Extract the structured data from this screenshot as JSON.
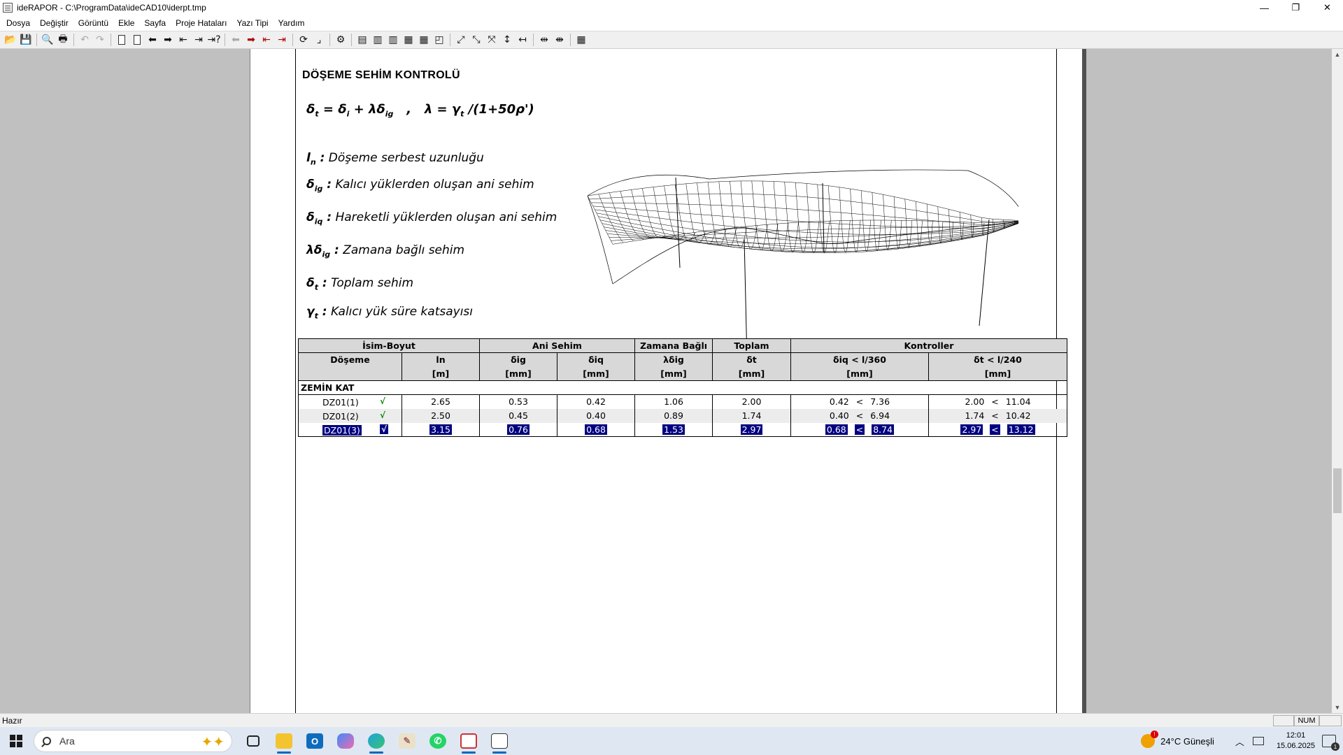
{
  "window": {
    "title": "ideRAPOR - C:\\ProgramData\\ideCAD10\\iderpt.tmp",
    "controls": {
      "minimize": "—",
      "restore": "❐",
      "close": "✕"
    }
  },
  "menu": [
    "Dosya",
    "Değiştir",
    "Görüntü",
    "Ekle",
    "Sayfa",
    "Proje Hataları",
    "Yazı Tipi",
    "Yardım"
  ],
  "toolbar": {
    "open": "📂",
    "save": "💾",
    "preview": "🔍",
    "print": "🖶",
    "undo": "↶",
    "redo": "↷",
    "prev": "⬅",
    "next": "➡",
    "first": "⇤",
    "last": "⇥",
    "goto": "⇥?",
    "icons": [
      "open-icon",
      "save-icon",
      "print-preview-icon",
      "print-icon",
      "undo-icon",
      "redo-icon"
    ]
  },
  "report": {
    "heading": "DÖŞEME SEHİM  KONTROLÜ",
    "legend": [
      {
        "sym": "l",
        "sub": "n",
        "text": " Döşeme serbest uzunluğu"
      },
      {
        "sym": "δ",
        "sub": "ig",
        "text": " Kalıcı yüklerden oluşan ani sehim"
      },
      {
        "sym": "δ",
        "sub": "iq",
        "text": " Hareketli yüklerden oluşan ani sehim"
      },
      {
        "sym": "λδ",
        "sub": "ig",
        "text": " Zamana bağlı sehim"
      },
      {
        "sym": "δ",
        "sub": "t",
        "text": " Toplam sehim"
      },
      {
        "sym": "γ",
        "sub": "t",
        "text": " Kalıcı yük süre katsayısı"
      }
    ],
    "table": {
      "groups": [
        "İsim-Boyut",
        "Ani Sehim",
        "Zamana Bağlı",
        "Toplam",
        "Kontroller"
      ],
      "subheaders": [
        "Döşeme",
        "ln",
        "δig",
        "δiq",
        "λδig",
        "δt",
        "δiq < l/360",
        "δt < l/240"
      ],
      "units": [
        "",
        "[m]",
        "[mm]",
        "[mm]",
        "[mm]",
        "[mm]",
        "[mm]",
        "[mm]"
      ],
      "section": "ZEMİN KAT",
      "rows": [
        {
          "name": "DZ01(1)",
          "check": "√",
          "ln": "2.65",
          "dig": "0.53",
          "diq": "0.42",
          "ldig": "1.06",
          "dt": "2.00",
          "c1a": "0.42",
          "c1op": "<",
          "c1b": "7.36",
          "c2a": "2.00",
          "c2op": "<",
          "c2b": "11.04"
        },
        {
          "name": "DZ01(2)",
          "check": "√",
          "ln": "2.50",
          "dig": "0.45",
          "diq": "0.40",
          "ldig": "0.89",
          "dt": "1.74",
          "c1a": "0.40",
          "c1op": "<",
          "c1b": "6.94",
          "c2a": "1.74",
          "c2op": "<",
          "c2b": "10.42"
        },
        {
          "name": "DZ01(3)",
          "check": "√",
          "ln": "3.15",
          "dig": "0.76",
          "diq": "0.68",
          "ldig": "1.53",
          "dt": "2.97",
          "c1a": "0.68",
          "c1op": "<",
          "c1b": "8.74",
          "c2a": "2.97",
          "c2op": "<",
          "c2b": "13.12"
        }
      ]
    }
  },
  "status": {
    "text": "Hazır",
    "num": "NUM"
  },
  "taskbar": {
    "search_placeholder": "Ara",
    "weather": "24°C  Güneşli",
    "time": "12:01",
    "date": "15.06.2025",
    "apps": [
      "task-view-icon",
      "file-explorer-icon",
      "outlook-icon",
      "copilot-icon",
      "edge-icon",
      "paint-icon",
      "whatsapp-icon",
      "app-icon",
      "iderapor-icon"
    ]
  }
}
